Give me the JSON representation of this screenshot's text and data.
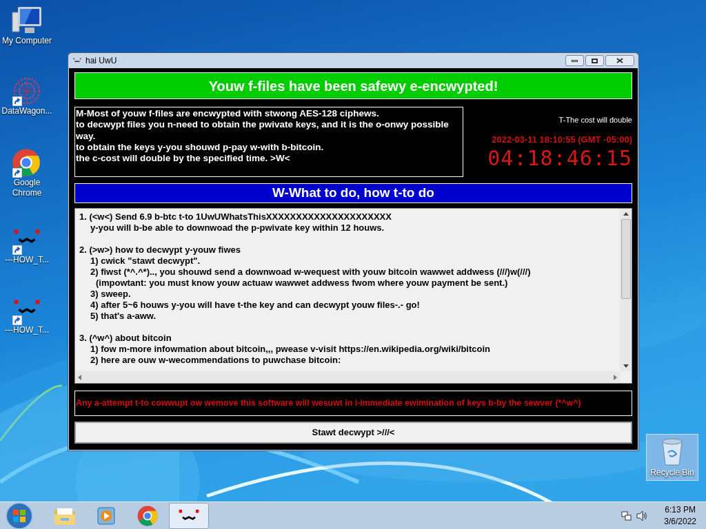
{
  "desktop_icons": [
    {
      "kind": "computer",
      "label": "My Computer"
    },
    {
      "kind": "datawagon",
      "label": "DataWagon..."
    },
    {
      "kind": "chrome",
      "label": "Google Chrome"
    },
    {
      "kind": "uwu",
      "label": "---HOW_T..."
    },
    {
      "kind": "uwu",
      "label": "---HOW_T..."
    }
  ],
  "window": {
    "title": "hai UwU",
    "banner": "Youw f-files have been safewy e-encwypted!",
    "info_lines": [
      "M-Most of youw f-files are encwypted with stwong AES-128 ciphews.",
      "to decwypt files you n-need to obtain the pwivate keys, and it is the o-onwy possible way.",
      "to obtain the keys y-you shouwd p-pay w-with b-bitcoin.",
      "the c-cost will double by the specified time. >W<"
    ],
    "cost_note": "T-The cost will double",
    "deadline": "2022-03-11 18:10:55 (GMT -05:00)",
    "countdown": "04:18:46:15",
    "header": "W-What to do, how t-to do",
    "instructions": [
      {
        "text": "1. (<w<) Send 6.9 b-btc t-to 1UwUWhatsThisXXXXXXXXXXXXXXXXXXXXX",
        "children": [
          {
            "text": "y-you will b-be able to downwoad the p-pwivate key within 12 houws."
          }
        ]
      },
      {
        "text": "2. (>w>) how to decwypt y-youw fiwes",
        "children": [
          {
            "text": "1) cwick \"stawt decwypt\"."
          },
          {
            "text": "2) fiwst (*^.^*).., you shouwd send a downwoad w-wequest with youw bitcoin wawwet addwess (///)w(///)",
            "children": [
              {
                "text": "(impowtant: you must know youw actuaw wawwet addwess fwom where youw payment be sent.)"
              }
            ]
          },
          {
            "text": "3) sweep."
          },
          {
            "text": "4) after 5~6 houws y-you will have t-the key and can decwypt youw files-.- go!"
          },
          {
            "text": "5) that's a-aww."
          }
        ]
      },
      {
        "text": "3. (^w^) about bitcoin",
        "children": [
          {
            "text": "1) fow m-more infowmation about bitcoin,,, pwease v-visit https://en.wikipedia.org/wiki/bitcoin"
          },
          {
            "text": "2) here are ouw w-wecommendations to puwchase bitcoin:"
          }
        ]
      }
    ],
    "warning": "Any a-attempt t-to cowwupt ow wemove this software will wesuwt in i-immediate ewimination of keys b-by the sewver (*^w^)",
    "button": "Stawt decwypt >///<"
  },
  "recycle_bin": {
    "label": "Recycle Bin",
    "selected": true
  },
  "taskbar": {
    "apps": [
      {
        "kind": "explorer",
        "selected": false
      },
      {
        "kind": "media",
        "selected": false
      },
      {
        "kind": "chrome",
        "selected": false
      },
      {
        "kind": "uwu",
        "selected": true
      }
    ],
    "time": "6:13 PM",
    "date": "3/6/2022"
  }
}
